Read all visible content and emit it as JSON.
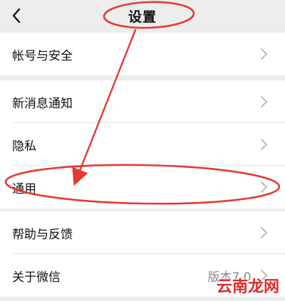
{
  "header": {
    "title": "设置",
    "back_icon": "chevron-left-icon"
  },
  "sections": [
    {
      "items": [
        {
          "label": "帐号与安全",
          "icon": "chevron-right-icon"
        }
      ]
    },
    {
      "items": [
        {
          "label": "新消息通知",
          "icon": "chevron-right-icon"
        },
        {
          "label": "隐私",
          "icon": "chevron-right-icon"
        },
        {
          "label": "通用",
          "icon": "chevron-right-icon"
        }
      ]
    },
    {
      "items": [
        {
          "label": "帮助与反馈",
          "icon": "chevron-right-icon"
        },
        {
          "label": "关于微信",
          "value": "版本7.0.",
          "icon": "chevron-right-icon"
        }
      ]
    }
  ],
  "annotation": {
    "color": "#e53935"
  },
  "watermark": "云南龙网"
}
